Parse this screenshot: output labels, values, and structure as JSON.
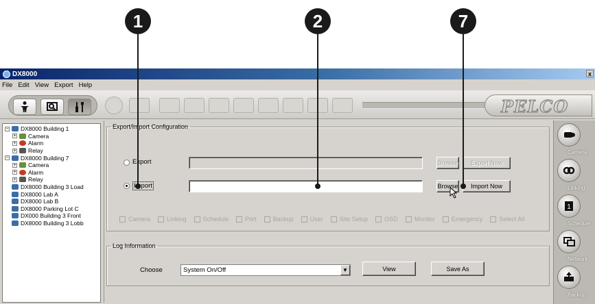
{
  "callouts": [
    "1",
    "2",
    "7"
  ],
  "window": {
    "title": "DX8000",
    "close_glyph": "x",
    "menu": [
      "File",
      "Edit",
      "View",
      "Export",
      "Help"
    ],
    "logo": "PELCO"
  },
  "tree": {
    "items": [
      {
        "label": "DX8000 Building 1",
        "level": 0,
        "expander": "−",
        "icon": "building-icon"
      },
      {
        "label": "Camera",
        "level": 1,
        "expander": "+",
        "icon": "camera-icon"
      },
      {
        "label": "Alarm",
        "level": 1,
        "expander": "+",
        "icon": "alarm-icon"
      },
      {
        "label": "Relay",
        "level": 1,
        "expander": "+",
        "icon": "relay-icon"
      },
      {
        "label": "DX8000 Building 7",
        "level": 0,
        "expander": "−",
        "icon": "building-icon"
      },
      {
        "label": "Camera",
        "level": 1,
        "expander": "+",
        "icon": "camera-icon"
      },
      {
        "label": "Alarm",
        "level": 1,
        "expander": "+",
        "icon": "alarm-icon"
      },
      {
        "label": "Relay",
        "level": 1,
        "expander": "+",
        "icon": "relay-icon"
      },
      {
        "label": "DX8000 Building 3 Load",
        "level": 0,
        "expander": "",
        "icon": "building-icon"
      },
      {
        "label": "DX8000 Lab A",
        "level": 0,
        "expander": "",
        "icon": "building-icon"
      },
      {
        "label": "DX8000 Lab B",
        "level": 0,
        "expander": "",
        "icon": "building-icon"
      },
      {
        "label": "DX8000 Parking Lot C",
        "level": 0,
        "expander": "",
        "icon": "building-icon"
      },
      {
        "label": "DX000 Building 3 Front",
        "level": 0,
        "expander": "",
        "icon": "building-icon"
      },
      {
        "label": "DX8000 Building 3 Lobb",
        "level": 0,
        "expander": "",
        "icon": "building-icon"
      }
    ]
  },
  "export_import": {
    "legend": "Export/Import Configuration",
    "export_label": "Export",
    "import_label": "Import",
    "export_path": "",
    "import_path": "",
    "browse_label": "Browse",
    "export_now_label": "Export Now",
    "import_now_label": "Import Now",
    "checkboxes": [
      "Camera",
      "Linking",
      "Schedule",
      "Port",
      "Backup",
      "User",
      "Site Setup",
      "OSD",
      "Monitor",
      "Emergency",
      "Select All"
    ]
  },
  "log": {
    "legend": "Log Information",
    "choose_label": "Choose",
    "selected": "System On/Off",
    "arrow_glyph": "▼",
    "view_label": "View",
    "save_as_label": "Save As"
  },
  "rail": {
    "items": [
      {
        "label": "Camera",
        "icon": "camera-icon"
      },
      {
        "label": "Linking",
        "icon": "linking-icon"
      },
      {
        "label": "Schedule",
        "icon": "schedule-icon"
      },
      {
        "label": "Network",
        "icon": "network-icon"
      },
      {
        "label": "Backup",
        "icon": "backup-icon"
      }
    ]
  },
  "colors": {
    "titlebar": "#0a246a",
    "window_bg": "#d6d3ce",
    "callout": "#1a1a1a"
  }
}
